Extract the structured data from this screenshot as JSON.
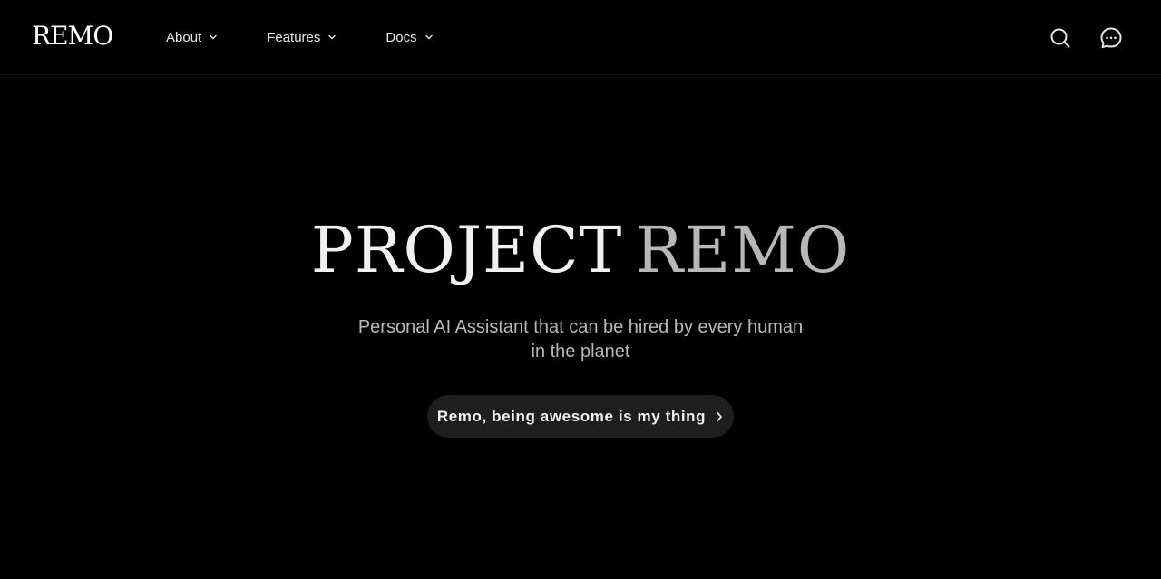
{
  "header": {
    "logo_text": "REMO",
    "nav": [
      {
        "label": "About"
      },
      {
        "label": "Features"
      },
      {
        "label": "Docs"
      }
    ],
    "actions": [
      "search-icon",
      "chat-icon"
    ]
  },
  "hero": {
    "title_part1": "PROJECT",
    "title_part2": "REMO",
    "subtitle": "Personal AI Assistant that can be hired by every human in the planet",
    "cta_label": "Remo, being awesome is my thing"
  },
  "colors": {
    "background": "#000000",
    "title_primary": "#f1f1f1",
    "title_secondary": "#b8b8b8",
    "subtitle": "#b9b9b9",
    "cta_bg": "#1e1e1e"
  }
}
